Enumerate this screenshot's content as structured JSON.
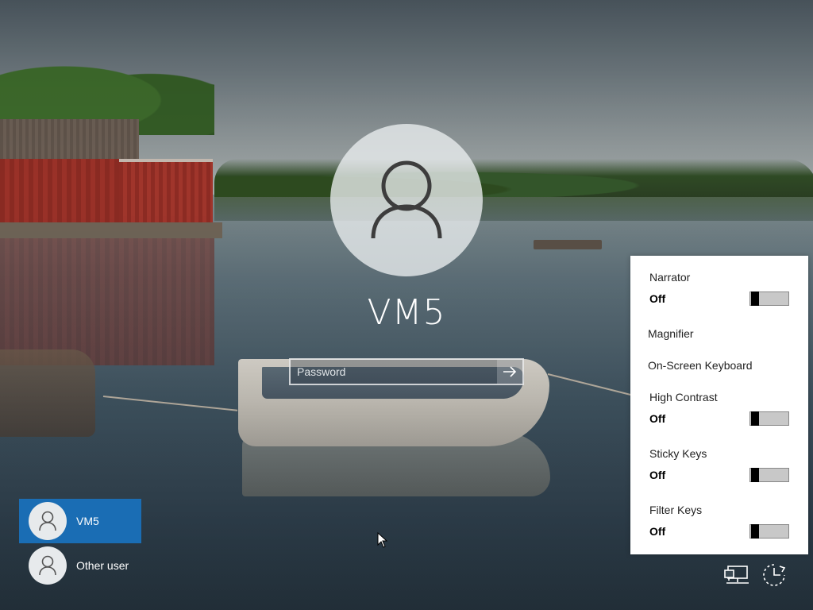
{
  "login": {
    "username": "VM5",
    "password_placeholder": "Password"
  },
  "users": [
    {
      "label": "VM5",
      "selected": true
    },
    {
      "label": "Other user",
      "selected": false
    }
  ],
  "ease_of_access": {
    "toggles": [
      {
        "name": "Narrator",
        "state": "Off"
      },
      {
        "name": "High Contrast",
        "state": "Off"
      },
      {
        "name": "Sticky Keys",
        "state": "Off"
      },
      {
        "name": "Filter Keys",
        "state": "Off"
      }
    ],
    "links": [
      "Magnifier",
      "On-Screen Keyboard"
    ]
  },
  "corner_icons": [
    "network-icon",
    "ease-of-access-icon"
  ],
  "colors": {
    "selected_tile": "#1a6db4",
    "panel_bg": "#ffffff"
  }
}
